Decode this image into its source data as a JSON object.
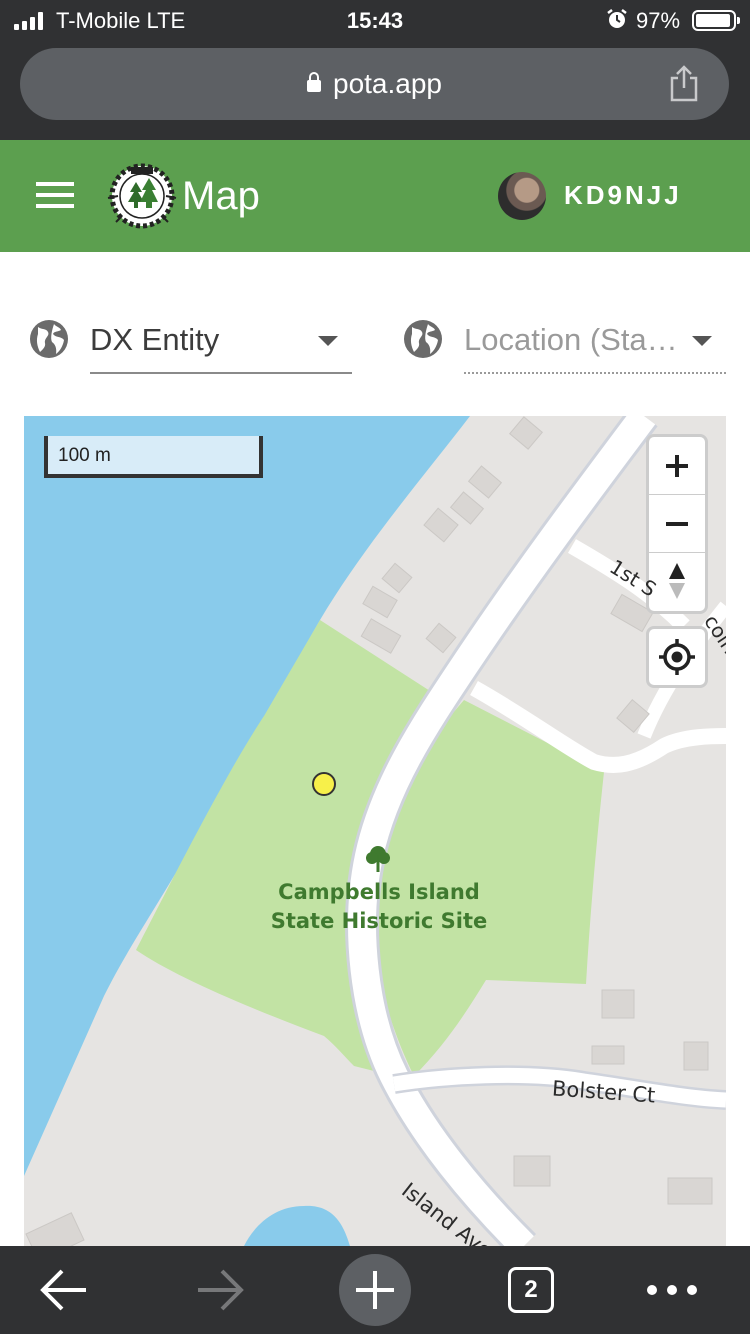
{
  "status_bar": {
    "carrier": "T-Mobile  LTE",
    "time": "15:43",
    "battery": "97%"
  },
  "browser": {
    "url": "pota.app",
    "tab_count": "2"
  },
  "header": {
    "title": "Map",
    "callsign": "KD9NJJ",
    "brand_color": "#5c9f4f"
  },
  "filters": {
    "dx_entity": "DX Entity",
    "location_placeholder": "Location (Sta…"
  },
  "map": {
    "scale_label": "100 m",
    "poi_name_line1": "Campbells Island",
    "poi_name_line2": "State Historic Site",
    "streets": {
      "first": "1st S",
      "lincoln": "coln",
      "bolster": "Bolster Ct",
      "island": "Island Ave"
    },
    "colors": {
      "water": "#89cbeb",
      "park": "#c2e3a4",
      "land": "#e6e4e2",
      "road": "#ffffff",
      "park_marker": "#f7f04a"
    }
  }
}
